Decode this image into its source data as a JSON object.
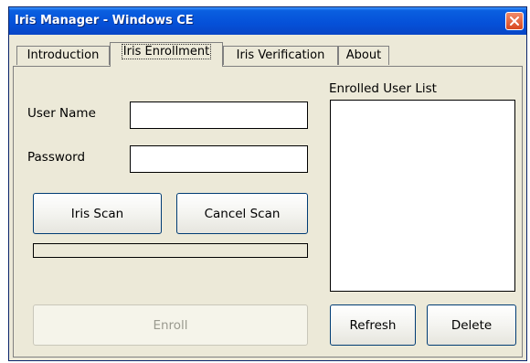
{
  "window": {
    "title": "Iris Manager - Windows CE"
  },
  "tabs": [
    {
      "label": "Introduction",
      "active": false
    },
    {
      "label": "Iris Enrollment",
      "active": true
    },
    {
      "label": "Iris Verification",
      "active": false
    },
    {
      "label": "About",
      "active": false
    }
  ],
  "form": {
    "user_name_label": "User Name",
    "user_name_value": "",
    "password_label": "Password",
    "password_value": ""
  },
  "buttons": {
    "iris_scan": "Iris Scan",
    "cancel_scan": "Cancel Scan",
    "enroll": "Enroll",
    "refresh": "Refresh",
    "delete": "Delete"
  },
  "scan_progress": 0,
  "enrolled_list": {
    "label": "Enrolled User List",
    "items": []
  },
  "icons": {
    "close": "close-icon"
  },
  "colors": {
    "titlebar": "#0550d8",
    "close_button": "#d9471d"
  }
}
